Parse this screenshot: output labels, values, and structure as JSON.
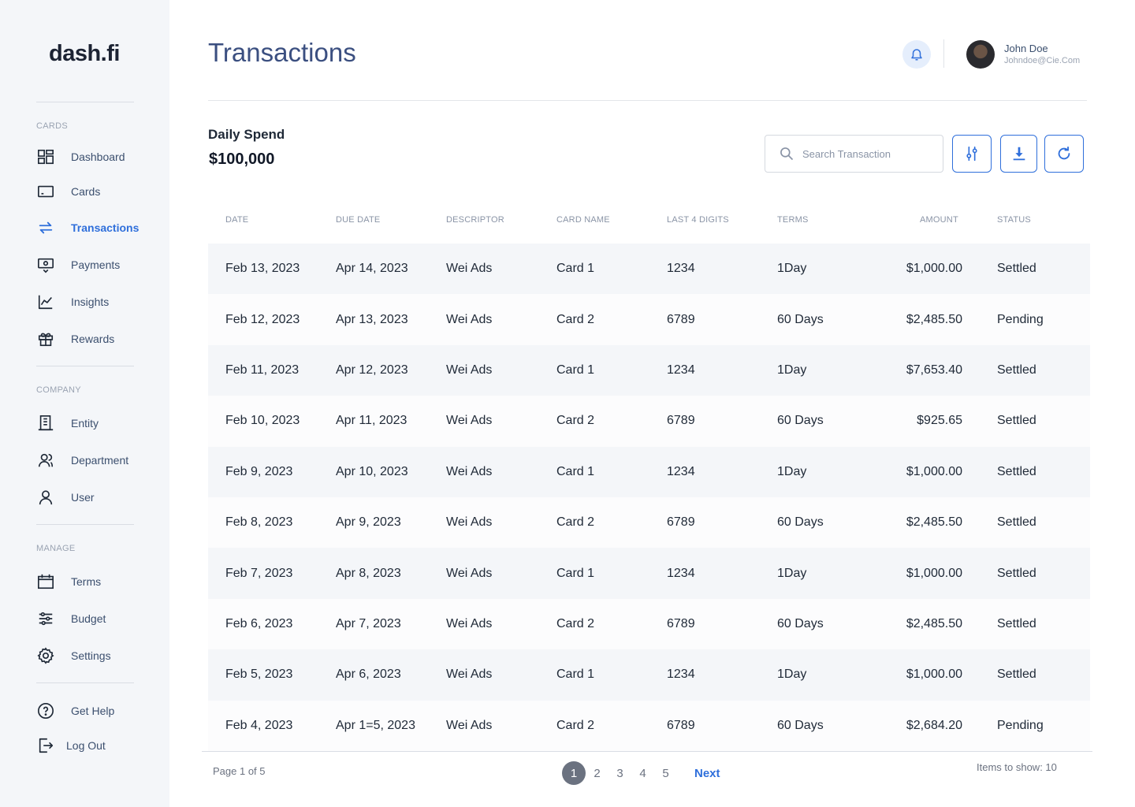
{
  "app": {
    "logo": "dash.fi",
    "title": "Transactions"
  },
  "sidebar": {
    "sections": [
      {
        "title": "CARDS"
      },
      {
        "title": "COMPANY"
      },
      {
        "title": "MANAGE"
      }
    ],
    "items": [
      {
        "label": "Dashboard",
        "icon": "dashboard-icon"
      },
      {
        "label": "Cards",
        "icon": "card-icon"
      },
      {
        "label": "Transactions",
        "icon": "transactions-icon",
        "active": true
      },
      {
        "label": "Payments",
        "icon": "payments-icon"
      },
      {
        "label": "Insights",
        "icon": "insights-icon"
      },
      {
        "label": "Rewards",
        "icon": "gift-icon"
      },
      {
        "label": "Entity",
        "icon": "building-icon"
      },
      {
        "label": "Department",
        "icon": "department-icon"
      },
      {
        "label": "User",
        "icon": "user-icon"
      },
      {
        "label": "Terms",
        "icon": "calendar-icon"
      },
      {
        "label": "Budget",
        "icon": "sliders-icon"
      },
      {
        "label": "Settings",
        "icon": "gear-icon"
      },
      {
        "label": "Get Help",
        "icon": "help-icon"
      },
      {
        "label": "Log Out",
        "icon": "logout-icon"
      }
    ]
  },
  "user": {
    "name": "John Doe",
    "email": "Johndoe@Cie.Com"
  },
  "summary": {
    "label": "Daily Spend",
    "value": "$100,000"
  },
  "search": {
    "placeholder": "Search Transaction",
    "value": ""
  },
  "colors": {
    "accent": "#2f6fdb",
    "title": "#3b4f80",
    "row_shade": "#f4f6f9"
  },
  "table": {
    "columns": [
      "DATE",
      "DUE DATE",
      "DESCRIPTOR",
      "CARD NAME",
      "LAST 4 DIGITS",
      "TERMS",
      "AMOUNT",
      "STATUS"
    ],
    "rows": [
      [
        "Feb 13, 2023",
        "Apr 14, 2023",
        "Wei Ads",
        "Card 1",
        "1234",
        "1Day",
        "$1,000.00",
        "Settled"
      ],
      [
        "Feb 12, 2023",
        "Apr 13, 2023",
        "Wei Ads",
        "Card 2",
        "6789",
        "60 Days",
        "$2,485.50",
        "Pending"
      ],
      [
        "Feb 11, 2023",
        "Apr 12, 2023",
        "Wei Ads",
        "Card 1",
        "1234",
        "1Day",
        "$7,653.40",
        "Settled"
      ],
      [
        "Feb 10, 2023",
        "Apr 11, 2023",
        "Wei Ads",
        "Card 2",
        "6789",
        "60 Days",
        "$925.65",
        "Settled"
      ],
      [
        "Feb 9, 2023",
        "Apr 10, 2023",
        "Wei Ads",
        "Card 1",
        "1234",
        "1Day",
        "$1,000.00",
        "Settled"
      ],
      [
        "Feb 8, 2023",
        "Apr 9, 2023",
        "Wei Ads",
        "Card 2",
        "6789",
        "60 Days",
        "$2,485.50",
        "Settled"
      ],
      [
        "Feb 7, 2023",
        "Apr 8, 2023",
        "Wei Ads",
        "Card 1",
        "1234",
        "1Day",
        "$1,000.00",
        "Settled"
      ],
      [
        "Feb 6, 2023",
        "Apr 7, 2023",
        "Wei Ads",
        "Card 2",
        "6789",
        "60 Days",
        "$2,485.50",
        "Settled"
      ],
      [
        "Feb 5, 2023",
        "Apr 6, 2023",
        "Wei Ads",
        "Card 1",
        "1234",
        "1Day",
        "$1,000.00",
        "Settled"
      ],
      [
        "Feb 4, 2023",
        "Apr 1=5, 2023",
        "Wei Ads",
        "Card 2",
        "6789",
        "60 Days",
        "$2,684.20",
        "Pending"
      ]
    ]
  },
  "pagination": {
    "info": "Page 1 of 5",
    "pages": [
      "1",
      "2",
      "3",
      "4",
      "5"
    ],
    "current": "1",
    "next_label": "Next",
    "items_to_show": "Items to show: 10"
  }
}
